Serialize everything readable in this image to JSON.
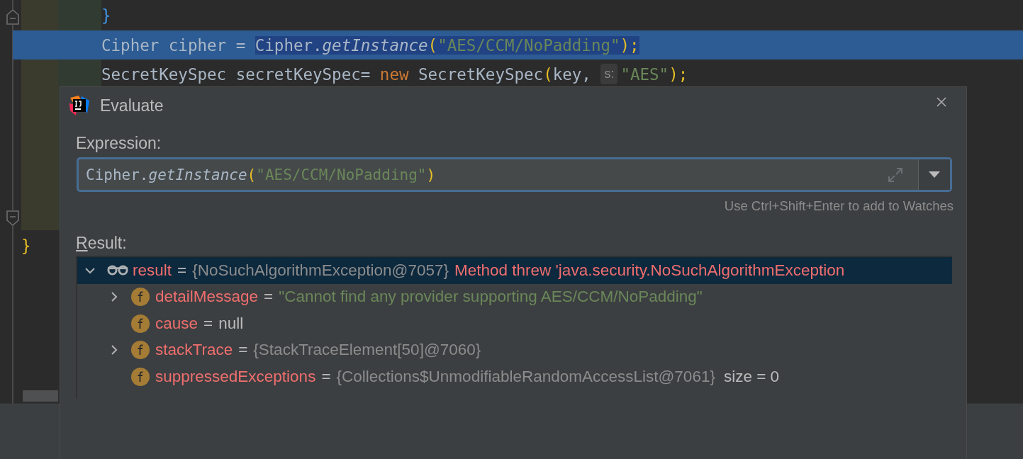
{
  "editor": {
    "lines": [
      {
        "highlighted": false,
        "tokens": [
          {
            "text": "}",
            "kind": "brace"
          }
        ]
      },
      {
        "highlighted": true,
        "tokens": [
          {
            "text": "Cipher cipher = ",
            "kind": "plain",
            "selected": false
          },
          {
            "text": "Cipher.",
            "kind": "plain",
            "selected": true
          },
          {
            "text": "getInstance",
            "kind": "method",
            "selected": true
          },
          {
            "text": "(",
            "kind": "paren",
            "selected": true
          },
          {
            "text": "\"AES/CCM/NoPadding\"",
            "kind": "string",
            "selected": true
          },
          {
            "text": ")",
            "kind": "paren",
            "selected": true
          },
          {
            "text": ";",
            "kind": "paren",
            "selected": true
          }
        ]
      },
      {
        "highlighted": false,
        "tokens": [
          {
            "text": "SecretKeySpec secretKeySpec= ",
            "kind": "plain"
          },
          {
            "text": "new",
            "kind": "keyword"
          },
          {
            "text": " SecretKeySpec",
            "kind": "plain"
          },
          {
            "text": "(",
            "kind": "paren"
          },
          {
            "text": "key, ",
            "kind": "plain"
          },
          {
            "text": "s:",
            "kind": "hint"
          },
          {
            "text": "\"AES\"",
            "kind": "string"
          },
          {
            "text": ")",
            "kind": "paren"
          },
          {
            "text": ";",
            "kind": "paren"
          }
        ]
      }
    ],
    "closing_line": {
      "tokens": [
        {
          "text": "}",
          "kind": "paren"
        }
      ]
    }
  },
  "dialog": {
    "title": "Evaluate",
    "expression_label": "Expression:",
    "expression": [
      {
        "text": "Cipher.",
        "kind": "plain"
      },
      {
        "text": "getInstance",
        "kind": "method"
      },
      {
        "text": "(",
        "kind": "paren"
      },
      {
        "text": "\"AES/CCM/NoPadding\"",
        "kind": "string"
      },
      {
        "text": ")",
        "kind": "paren"
      }
    ],
    "hint": "Use Ctrl+Shift+Enter to add to Watches",
    "result_label": "Result:",
    "tree": [
      {
        "kind": "watch",
        "name": "result",
        "separator": "=",
        "value": {
          "text": "{NoSuchAlgorithmException@7057}",
          "kind": "object"
        },
        "message": "Method threw 'java.security.NoSuchAlgorithmException",
        "expandable": true,
        "expanded": true,
        "selected": true,
        "children": [
          {
            "kind": "field",
            "name": "detailMessage",
            "separator": "=",
            "value": {
              "text": "\"Cannot find any provider supporting AES/CCM/NoPadding\"",
              "kind": "string"
            },
            "expandable": true,
            "expanded": false,
            "selected": false
          },
          {
            "kind": "field",
            "name": "cause",
            "separator": "=",
            "value": {
              "text": "null",
              "kind": "null"
            },
            "expandable": false,
            "selected": false
          },
          {
            "kind": "field",
            "name": "stackTrace",
            "separator": "=",
            "value": {
              "text": "{StackTraceElement[50]@7060}",
              "kind": "object"
            },
            "expandable": true,
            "expanded": false,
            "selected": false
          },
          {
            "kind": "field",
            "name": "suppressedExceptions",
            "separator": "=",
            "value": {
              "text": "{Collections$UnmodifiableRandomAccessList@7061}",
              "kind": "object"
            },
            "extra": "size = 0",
            "expandable": false,
            "selected": false
          }
        ]
      }
    ]
  }
}
